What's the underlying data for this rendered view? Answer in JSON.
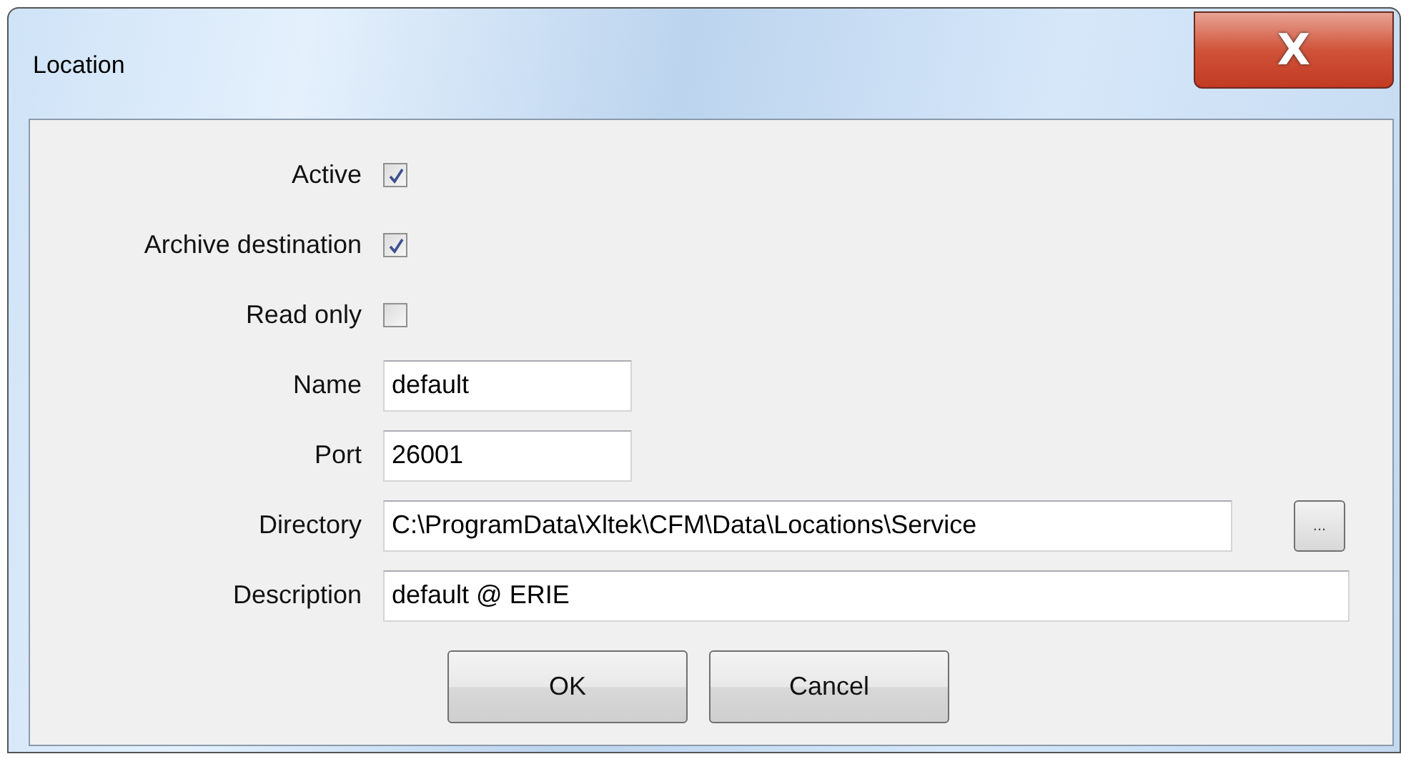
{
  "window": {
    "title": "Location",
    "close": "X"
  },
  "rows": [
    {
      "kind": "checkbox",
      "label": "Active",
      "checked": true
    },
    {
      "kind": "checkbox",
      "label": "Archive destination",
      "checked": true
    },
    {
      "kind": "checkbox",
      "label": "Read only",
      "checked": false
    },
    {
      "kind": "short",
      "label": "Name",
      "value": "default"
    },
    {
      "kind": "short",
      "label": "Port",
      "value": "26001"
    },
    {
      "kind": "browse",
      "label": "Directory",
      "value": "C:\\ProgramData\\Xltek\\CFM\\Data\\Locations\\Service",
      "button": "..."
    },
    {
      "kind": "wide",
      "label": "Description",
      "value": "default @ ERIE"
    }
  ],
  "buttons": [
    "OK",
    "Cancel"
  ]
}
